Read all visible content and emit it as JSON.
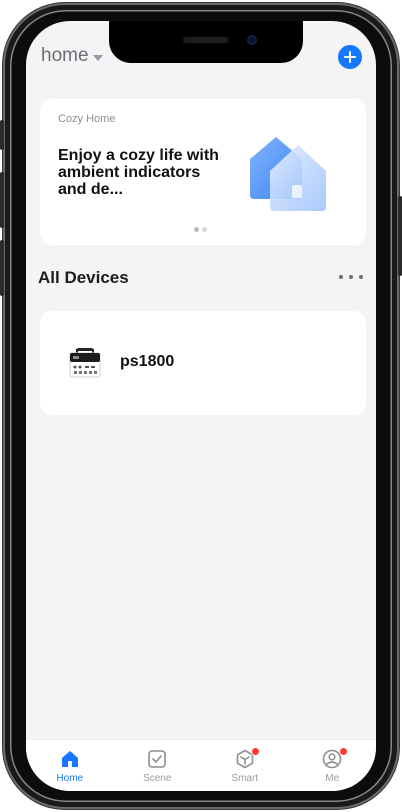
{
  "header": {
    "home_label": "home"
  },
  "banner": {
    "subtitle": "Cozy Home",
    "title": "Enjoy a cozy life with ambient indicators and de..."
  },
  "devices": {
    "section_title": "All Devices",
    "items": [
      {
        "name": "ps1800"
      }
    ]
  },
  "tabbar": {
    "tabs": [
      {
        "label": "Home",
        "active": true
      },
      {
        "label": "Scene",
        "active": false
      },
      {
        "label": "Smart",
        "active": false,
        "badge": true
      },
      {
        "label": "Me",
        "active": false,
        "badge": true
      }
    ]
  },
  "colors": {
    "accent": "#1677ff",
    "badge": "#ff3b30",
    "background": "#f4f4f6"
  },
  "icons": {
    "add": "plus-circle-icon",
    "more": "more-horizontal-icon",
    "home_tab": "house-icon",
    "scene_tab": "checkbox-icon",
    "smart_tab": "cube-icon",
    "me_tab": "user-circle-icon"
  }
}
